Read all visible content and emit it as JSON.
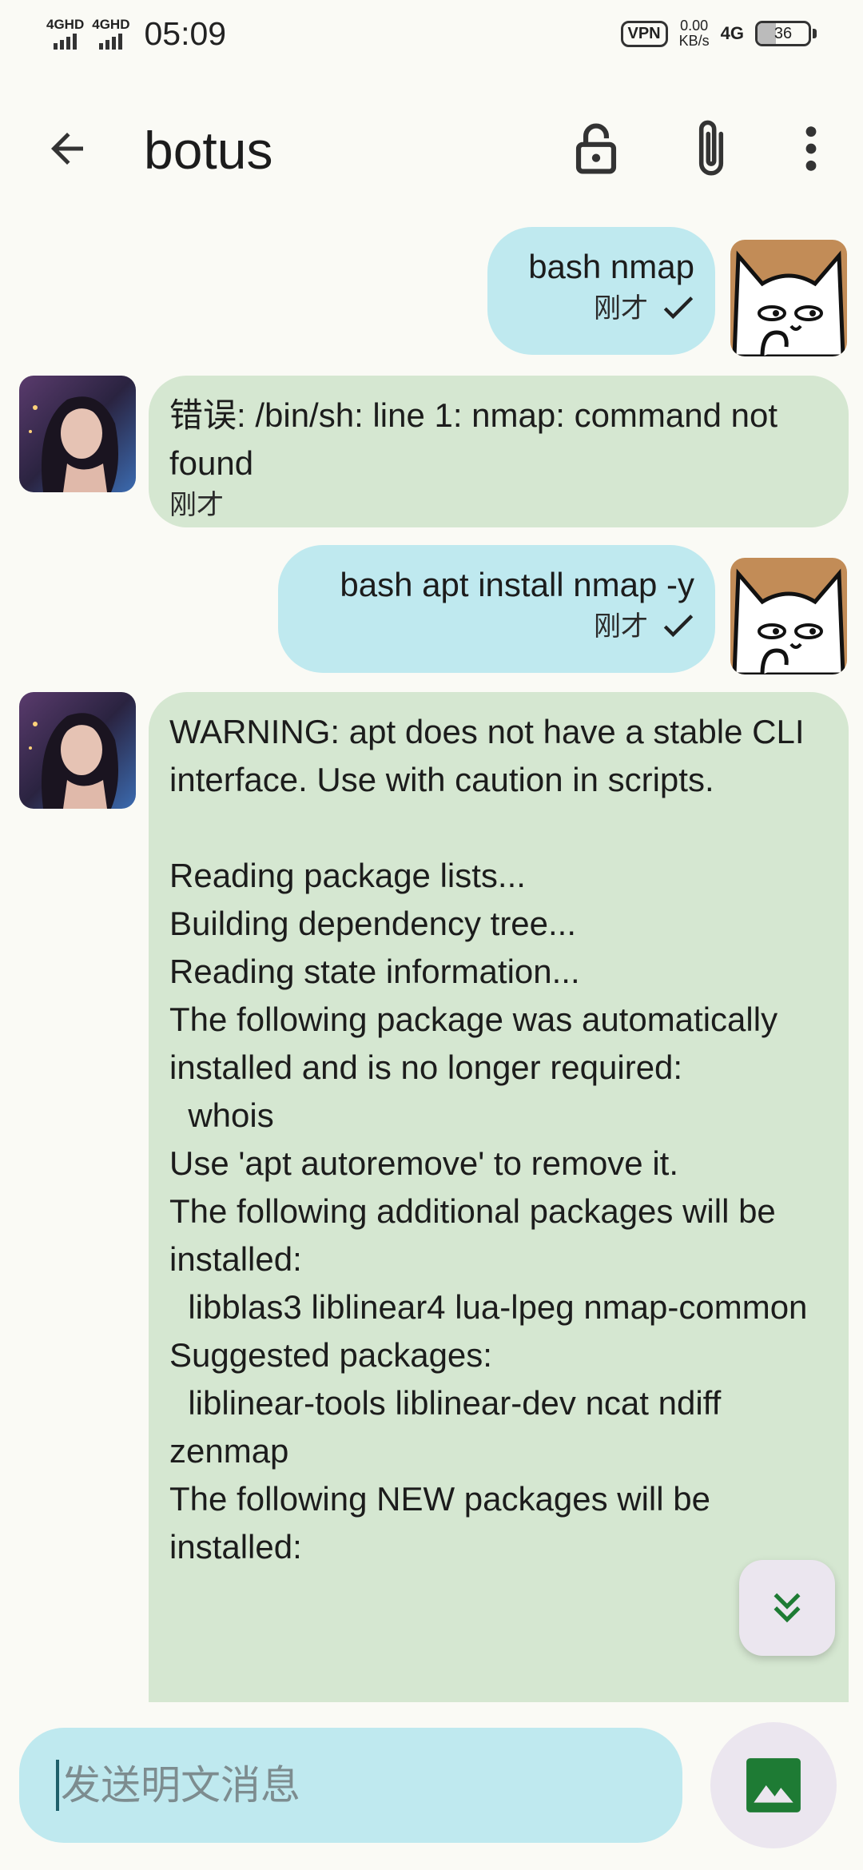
{
  "status_bar": {
    "network1": "4GHD",
    "network2": "4GHD",
    "time": "05:09",
    "vpn": "VPN",
    "speed_value": "0.00",
    "speed_unit": "KB/s",
    "network_type": "4G",
    "battery": "36",
    "battery_level": 0.36
  },
  "header": {
    "title": "botus",
    "back_icon": "arrow-back-icon",
    "lock_icon": "lock-open-icon",
    "attach_icon": "paperclip-icon",
    "more_icon": "more-vertical-icon"
  },
  "messages": [
    {
      "direction": "outgoing",
      "text": "bash nmap",
      "time": "刚才",
      "status": "sent"
    },
    {
      "direction": "incoming",
      "text": "错误: /bin/sh: line 1: nmap: command not found",
      "time": "刚才"
    },
    {
      "direction": "outgoing",
      "text": "bash apt install nmap -y",
      "time": "刚才",
      "status": "sent"
    },
    {
      "direction": "incoming",
      "text": "WARNING: apt does not have a stable CLI interface. Use with caution in scripts.\n\nReading package lists...\nBuilding dependency tree...\nReading state information...\nThe following package was automatically installed and is no longer required:\n  whois\nUse 'apt autoremove' to remove it.\nThe following additional packages will be installed:\n  libblas3 liblinear4 lua-lpeg nmap-common\nSuggested packages:\n  liblinear-tools liblinear-dev ncat ndiff zenmap\nThe following NEW packages will be installed:"
    }
  ],
  "composer": {
    "placeholder": "发送明文消息",
    "image_icon": "image-icon",
    "scroll_icon": "double-chevron-down-icon"
  },
  "colors": {
    "outgoing_bubble": "#bfe9ef",
    "incoming_bubble": "#d5e7d1",
    "background": "#fafaf5",
    "accent_green": "#1e7b34"
  }
}
